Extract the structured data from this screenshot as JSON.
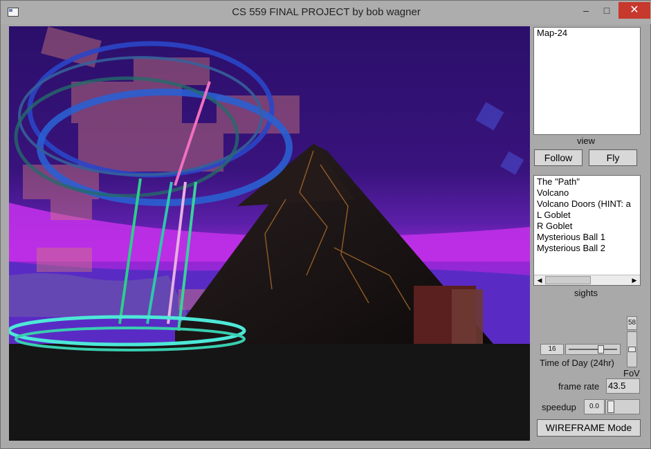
{
  "window": {
    "title": "CS 559 FINAL PROJECT by bob wagner",
    "minimize": "–",
    "maximize": "□",
    "close": "✕"
  },
  "viewport": {
    "description_icon": "3d-scene"
  },
  "view_panel": {
    "items": [
      "Map-24"
    ],
    "label": "view"
  },
  "camera_buttons": {
    "follow": "Follow",
    "fly": "Fly"
  },
  "sights_panel": {
    "items": [
      "The \"Path\"",
      "Volcano",
      "Volcano Doors (HINT: a",
      "L Goblet",
      "R Goblet",
      "Mysterious Ball 1",
      "Mysterious Ball 2"
    ],
    "label": "sights"
  },
  "time_of_day": {
    "value": "16",
    "label": "Time of Day (24hr)",
    "level": 0.67
  },
  "fov": {
    "value": "58",
    "label": "FoV",
    "level": 0.5
  },
  "frame_rate": {
    "label": "frame rate",
    "value": "43.5"
  },
  "speedup": {
    "label": "speedup",
    "value": "0.0",
    "level": 0.0
  },
  "wireframe_button": "WIREFRAME Mode"
}
